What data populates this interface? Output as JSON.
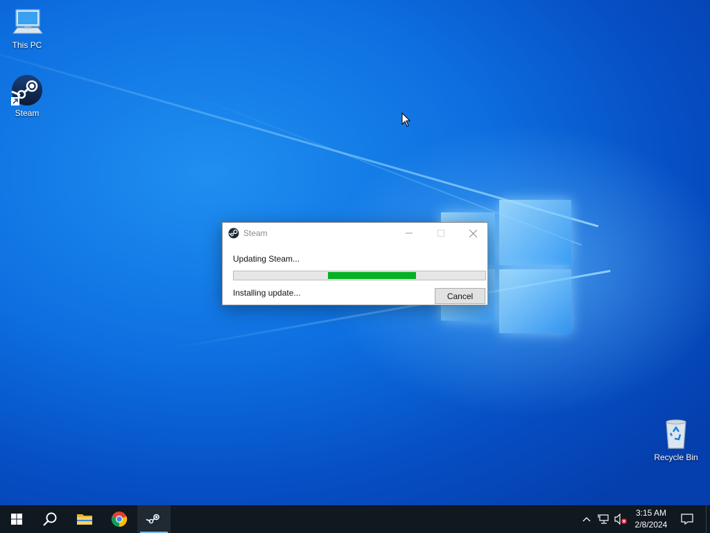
{
  "desktop": {
    "icons": [
      {
        "label": "This PC",
        "icon": "computer-icon"
      },
      {
        "label": "Steam",
        "icon": "steam-icon"
      },
      {
        "label": "Recycle Bin",
        "icon": "recycle-bin-icon"
      }
    ]
  },
  "dialog": {
    "title": "Steam",
    "status": "Updating Steam...",
    "progress": {
      "start_fraction": 0.375,
      "end_fraction": 0.725,
      "color": "#06b025"
    },
    "substatus": "Installing update...",
    "cancel_label": "Cancel"
  },
  "taskbar": {
    "items": [
      {
        "name": "start",
        "icon": "windows-icon"
      },
      {
        "name": "search",
        "icon": "search-icon"
      },
      {
        "name": "file-explorer",
        "icon": "folder-icon"
      },
      {
        "name": "chrome",
        "icon": "chrome-icon"
      },
      {
        "name": "steam",
        "icon": "steam-icon",
        "active": true
      }
    ],
    "tray": {
      "chevron": "^",
      "network_icon": "network-icon",
      "volume_icon": "volume-muted-icon"
    },
    "clock": {
      "time": "3:15 AM",
      "date": "2/8/2024"
    },
    "notification_icon": "notification-icon"
  },
  "colors": {
    "accent": "#0a63d3",
    "taskbar": "#101820",
    "progress": "#06b025"
  }
}
